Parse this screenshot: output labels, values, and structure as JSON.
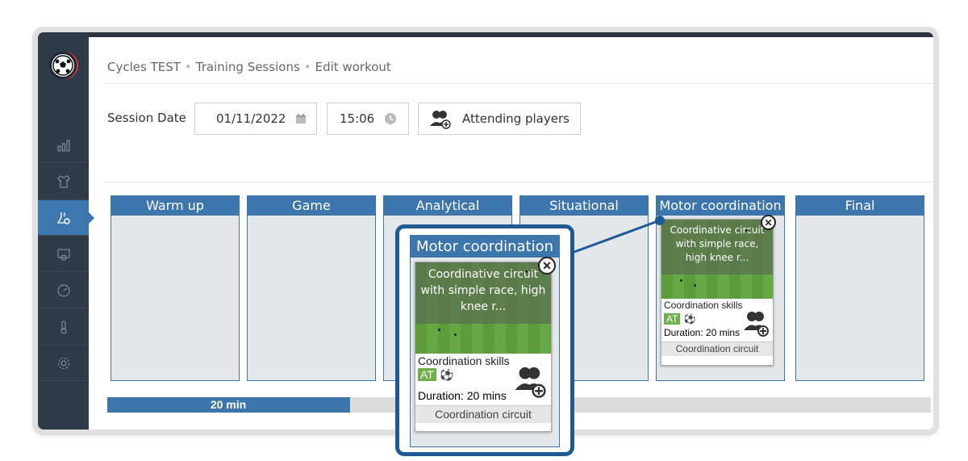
{
  "breadcrumb": {
    "item1": "Cycles TEST",
    "item2": "Training Sessions",
    "item3": "Edit workout",
    "separator": "•"
  },
  "session": {
    "label": "Session Date",
    "date": "01/11/2022",
    "time": "15:06",
    "attending_label": "Attending players"
  },
  "columns": [
    {
      "label": "Warm up"
    },
    {
      "label": "Game"
    },
    {
      "label": "Analytical"
    },
    {
      "label": "Situational"
    },
    {
      "label": "Motor coordination"
    },
    {
      "label": "Final"
    }
  ],
  "card": {
    "title": "Coordinative circuit with simple race, high knee r...",
    "skill": "Coordination skills",
    "tag": "AT",
    "duration": "Duration: 20 mins",
    "category": "Coordination circuit"
  },
  "callout": {
    "header": "Motor coordination"
  },
  "progress": {
    "label": "20 min",
    "fraction": 0.295
  },
  "colors": {
    "accent": "#3c76ad",
    "sidebar": "#2f3b48",
    "field_green": "#5c9c3a",
    "callout_border": "#1d5a96"
  },
  "icons": [
    "soccer-ball-icon",
    "bar-chart-icon",
    "jersey-icon",
    "flask-gear-icon",
    "whistle-icon",
    "speedometer-icon",
    "thermometer-icon",
    "settings-icon",
    "calendar-icon",
    "clock-icon",
    "add-players-icon",
    "close-icon"
  ]
}
